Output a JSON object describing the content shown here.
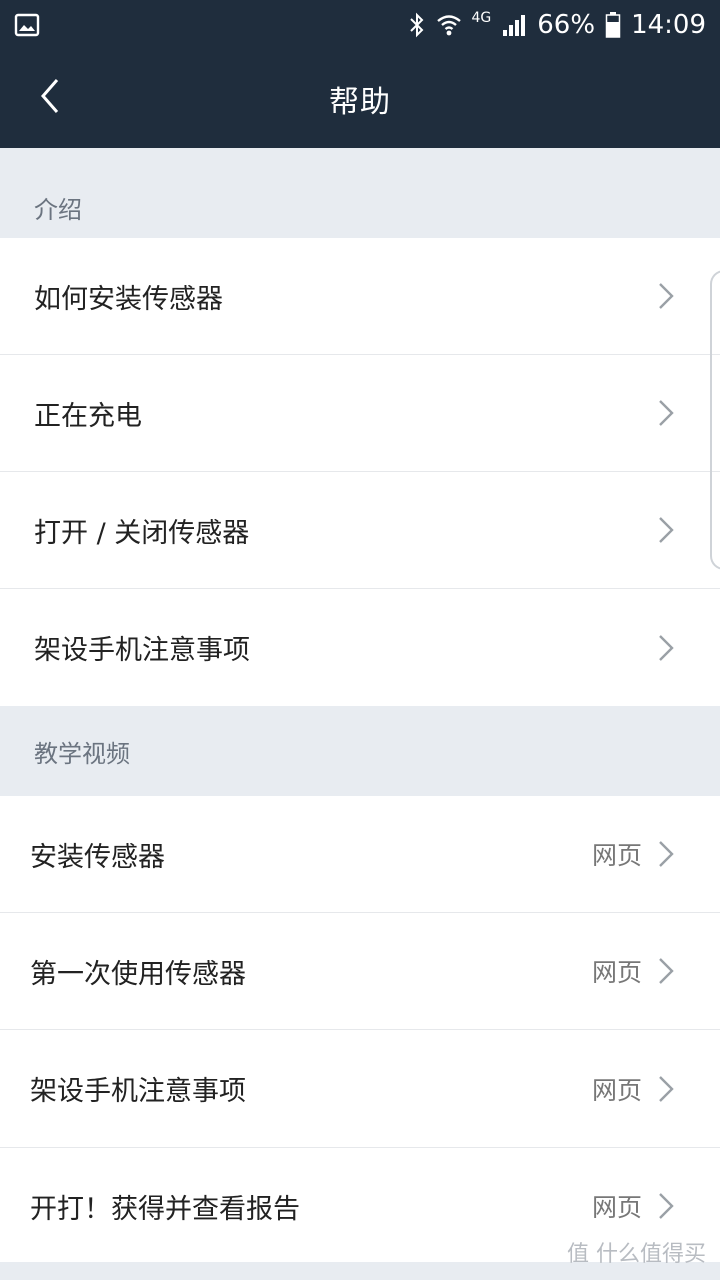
{
  "status_bar": {
    "network": "4G",
    "battery": "66%",
    "time": "14:09",
    "icons": [
      "gallery-icon",
      "bluetooth-icon",
      "wifi-icon",
      "signal-icon",
      "battery-icon"
    ]
  },
  "header": {
    "title": "帮助",
    "back_icon": "chevron-left-icon"
  },
  "sections": [
    {
      "title": "介绍",
      "items": [
        {
          "label": "如何安装传感器"
        },
        {
          "label": "正在充电"
        },
        {
          "label": "打开 / 关闭传感器"
        },
        {
          "label": "架设手机注意事项"
        }
      ]
    },
    {
      "title": "教学视频",
      "items": [
        {
          "label": "安装传感器",
          "tag": "网页"
        },
        {
          "label": "第一次使用传感器",
          "tag": "网页"
        },
        {
          "label": "架设手机注意事项",
          "tag": "网页"
        },
        {
          "label": "开打！获得并查看报告",
          "tag": "网页"
        }
      ]
    }
  ],
  "watermark": "值 什么值得买",
  "colors": {
    "header_bg": "#1f2d3d",
    "page_bg": "#e8ecf1",
    "section_text": "#6b7480",
    "chevron": "#9aa0a6"
  }
}
